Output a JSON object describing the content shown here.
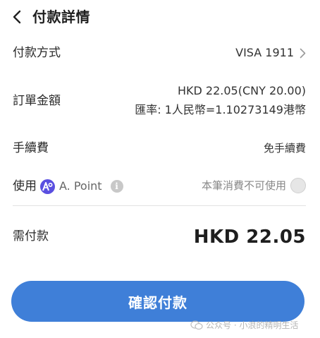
{
  "header": {
    "title": "付款詳情"
  },
  "payment_method": {
    "label": "付款方式",
    "value": "VISA 1911"
  },
  "order": {
    "label": "訂單金額",
    "amount": "HKD 22.05(CNY 20.00)",
    "rate": "匯率: 1人民幣=1.10273149港幣"
  },
  "fee": {
    "label": "手續費",
    "value": "免手續費"
  },
  "points": {
    "use_label": "使用",
    "name": "A. Point",
    "info_glyph": "i",
    "note": "本筆消費不可使用",
    "enabled": false,
    "logo_color": "#5a4fe0"
  },
  "total": {
    "label": "需付款",
    "value": "HKD 22.05"
  },
  "confirm_button": {
    "label": "確認付款",
    "color": "#3f7fd8"
  },
  "watermark": {
    "text": "公众号 · 小浪的精明生活"
  }
}
